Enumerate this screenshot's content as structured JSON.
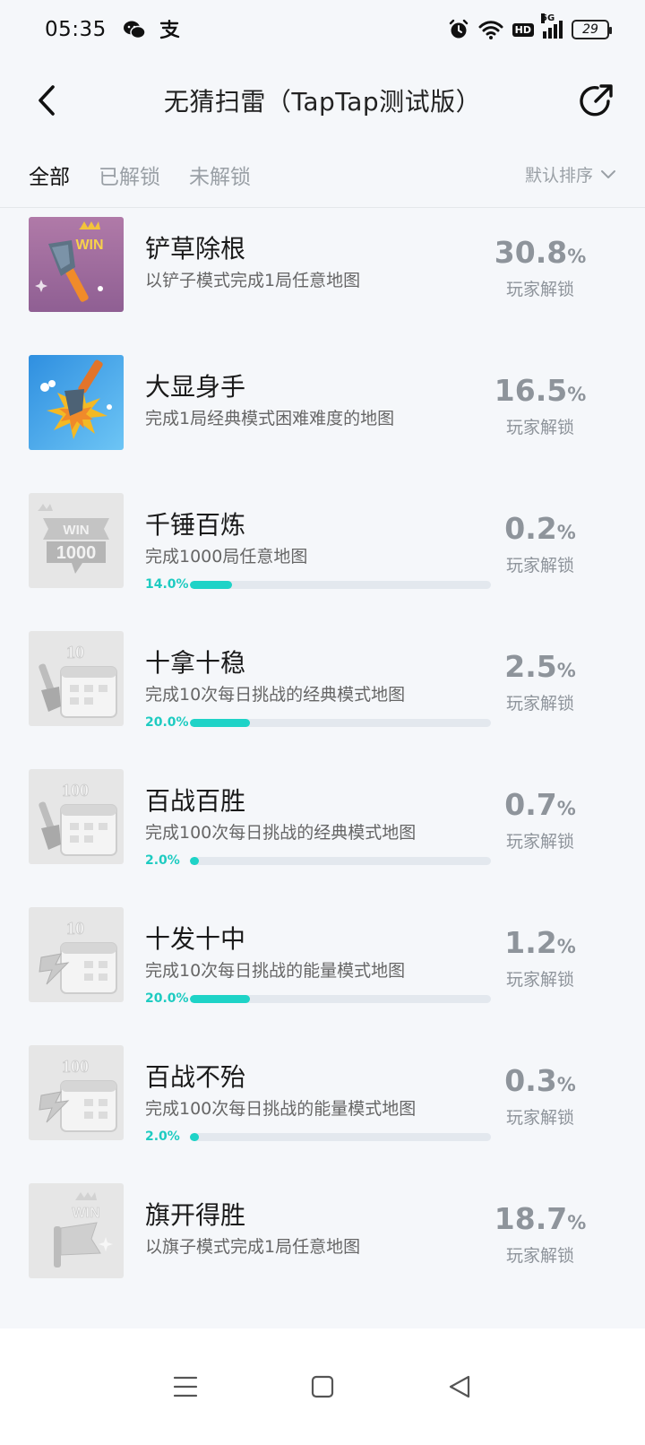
{
  "status_bar": {
    "time": "05:35",
    "left_icons": [
      "wechat-icon",
      "alipay-icon"
    ],
    "right_icons": [
      "alarm-icon",
      "wifi-icon",
      "hd-icon",
      "signal-5g-icon"
    ],
    "hd_label": "HD",
    "network_label": "5G",
    "battery": "29"
  },
  "header": {
    "title": "无猜扫雷（TapTap测试版）",
    "back_icon": "chevron-left-icon",
    "share_icon": "share-icon"
  },
  "tabs": [
    {
      "label": "全部",
      "active": true
    },
    {
      "label": "已解锁",
      "active": false
    },
    {
      "label": "未解锁",
      "active": false
    }
  ],
  "sort": {
    "label": "默认排序",
    "icon": "chevron-down-icon"
  },
  "accent_color": "#1ed3c7",
  "achievements": [
    {
      "title": "铲草除根",
      "desc": "以铲子模式完成1局任意地图",
      "percent": "30.8",
      "pct_sign": "%",
      "stat_label": "玩家解锁",
      "unlocked": true,
      "progress": null,
      "icon": "shovel-win-icon"
    },
    {
      "title": "大显身手",
      "desc": "完成1局经典模式困难难度的地图",
      "percent": "16.5",
      "pct_sign": "%",
      "stat_label": "玩家解锁",
      "unlocked": true,
      "progress": null,
      "icon": "shovel-explosion-icon"
    },
    {
      "title": "千锤百炼",
      "desc": "完成1000局任意地图",
      "percent": "0.2",
      "pct_sign": "%",
      "stat_label": "玩家解锁",
      "unlocked": false,
      "progress": "14.0%",
      "progress_value": 0.14,
      "icon": "win-1000-icon"
    },
    {
      "title": "十拿十稳",
      "desc": "完成10次每日挑战的经典模式地图",
      "percent": "2.5",
      "pct_sign": "%",
      "stat_label": "玩家解锁",
      "unlocked": false,
      "progress": "20.0%",
      "progress_value": 0.2,
      "icon": "calendar-10-shovel-icon"
    },
    {
      "title": "百战百胜",
      "desc": "完成100次每日挑战的经典模式地图",
      "percent": "0.7",
      "pct_sign": "%",
      "stat_label": "玩家解锁",
      "unlocked": false,
      "progress": "2.0%",
      "progress_value": 0.02,
      "icon": "calendar-100-shovel-icon"
    },
    {
      "title": "十发十中",
      "desc": "完成10次每日挑战的能量模式地图",
      "percent": "1.2",
      "pct_sign": "%",
      "stat_label": "玩家解锁",
      "unlocked": false,
      "progress": "20.0%",
      "progress_value": 0.2,
      "icon": "calendar-10-energy-icon"
    },
    {
      "title": "百战不殆",
      "desc": "完成100次每日挑战的能量模式地图",
      "percent": "0.3",
      "pct_sign": "%",
      "stat_label": "玩家解锁",
      "unlocked": false,
      "progress": "2.0%",
      "progress_value": 0.02,
      "icon": "calendar-100-energy-icon"
    },
    {
      "title": "旗开得胜",
      "desc": "以旗子模式完成1局任意地图",
      "percent": "18.7",
      "pct_sign": "%",
      "stat_label": "玩家解锁",
      "unlocked": false,
      "progress": null,
      "icon": "flag-win-icon"
    }
  ],
  "thumb_labels": {
    "win": "WIN",
    "n1000": "1000",
    "n10": "10",
    "n100": "100"
  },
  "nav_bar": {
    "icons": [
      "menu-icon",
      "home-icon",
      "back-triangle-icon"
    ]
  }
}
